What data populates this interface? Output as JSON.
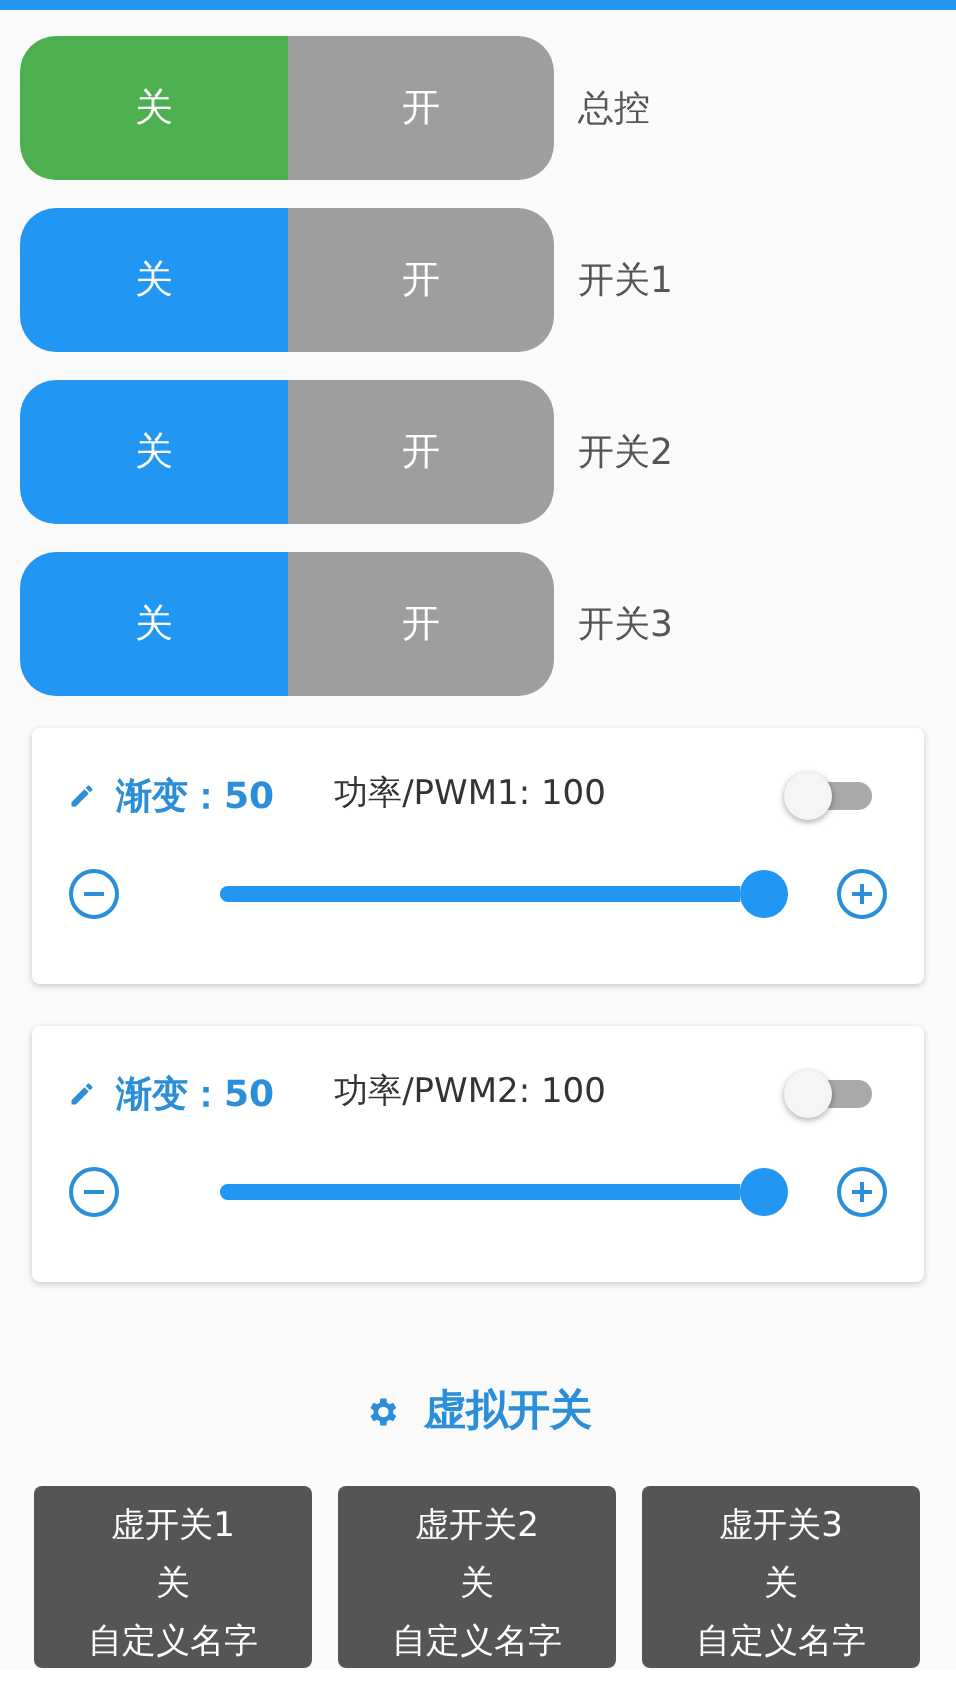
{
  "switches": [
    {
      "label": "总控",
      "color": "#4caf50",
      "options": [
        {
          "text": "关",
          "selected": true
        },
        {
          "text": "开",
          "selected": false
        }
      ]
    },
    {
      "label": "开关1",
      "color": "#2196f3",
      "options": [
        {
          "text": "关",
          "selected": true
        },
        {
          "text": "开",
          "selected": false
        }
      ]
    },
    {
      "label": "开关2",
      "color": "#2196f3",
      "options": [
        {
          "text": "关",
          "selected": true
        },
        {
          "text": "开",
          "selected": false
        }
      ]
    },
    {
      "label": "开关3",
      "color": "#2196f3",
      "options": [
        {
          "text": "关",
          "selected": true
        },
        {
          "text": "开",
          "selected": false
        }
      ]
    }
  ],
  "channels": [
    {
      "fade": "渐变：50",
      "power": "功率/PWM1: 100",
      "on": false,
      "level": 1
    },
    {
      "fade": "渐变：50",
      "power": "功率/PWM2: 100",
      "on": false,
      "level": 1
    }
  ],
  "virtual_section": {
    "title": "虚拟开关",
    "buttons": [
      {
        "name": "虚开关1",
        "state": "关",
        "caption": "自定义名字"
      },
      {
        "name": "虚开关2",
        "state": "关",
        "caption": "自定义名字"
      },
      {
        "name": "虚开关3",
        "state": "关",
        "caption": "自定义名字"
      }
    ]
  }
}
